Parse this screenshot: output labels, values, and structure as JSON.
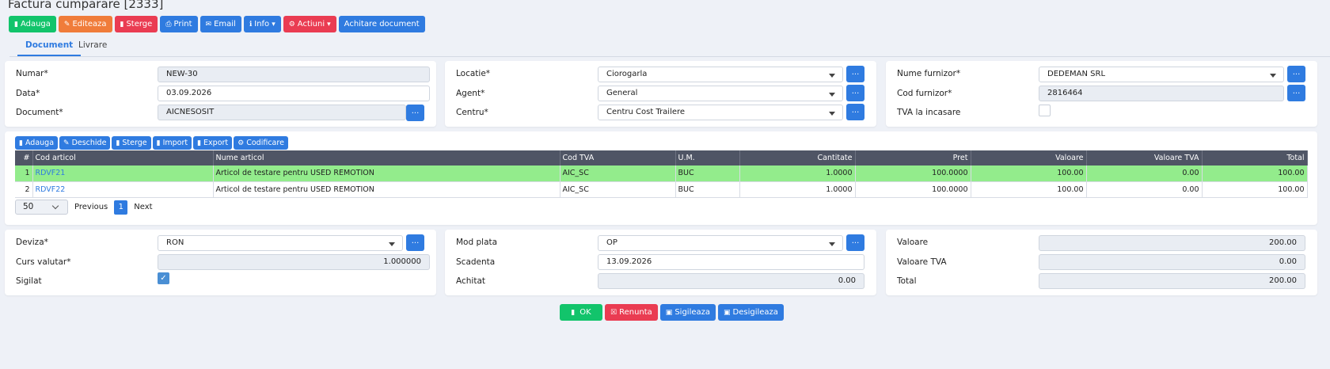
{
  "title": "Factura cumparare [2333]",
  "toolbar": {
    "add": "Adauga",
    "edit": "Editeaza",
    "delete": "Sterge",
    "print": "Print",
    "email": "Email",
    "info": "Info",
    "actions": "Actiuni",
    "pay": "Achitare document"
  },
  "tabs": {
    "document": "Document",
    "delivery": "Livrare"
  },
  "header": {
    "numar": {
      "label": "Numar*",
      "value": "NEW-30"
    },
    "data": {
      "label": "Data*",
      "value": "03.09.2026"
    },
    "document": {
      "label": "Document*",
      "value": "AICNESOSIT"
    },
    "locatie": {
      "label": "Locatie*",
      "value": "Ciorogarla"
    },
    "agent": {
      "label": "Agent*",
      "value": "General"
    },
    "centru": {
      "label": "Centru*",
      "value": "Centru Cost Trailere"
    },
    "furnizor": {
      "label": "Nume furnizor*",
      "value": "DEDEMAN SRL"
    },
    "cod_furnizor": {
      "label": "Cod furnizor*",
      "value": "2816464"
    },
    "tva_incasare": {
      "label": "TVA la incasare",
      "checked": false
    },
    "dots": "..."
  },
  "items_toolbar": {
    "add": "Adauga",
    "open": "Deschide",
    "delete": "Sterge",
    "import": "Import",
    "export": "Export",
    "coding": "Codificare"
  },
  "table": {
    "columns": [
      "#",
      "Cod articol",
      "Nume articol",
      "Cod TVA",
      "U.M.",
      "Cantitate",
      "Pret",
      "Valoare",
      "Valoare TVA",
      "Total"
    ],
    "rows": [
      [
        "1",
        "RDVF21",
        "Articol de testare pentru USED REMOTION",
        "AIC_SC",
        "BUC",
        "1.0000",
        "100.0000",
        "100.00",
        "0.00",
        "100.00"
      ],
      [
        "2",
        "RDVF22",
        "Articol de testare pentru USED REMOTION",
        "AIC_SC",
        "BUC",
        "1.0000",
        "100.0000",
        "100.00",
        "0.00",
        "100.00"
      ]
    ]
  },
  "pager": {
    "page_size": "50",
    "previous": "Previous",
    "page": "1",
    "next": "Next"
  },
  "footer": {
    "deviza": {
      "label": "Deviza*",
      "value": "RON"
    },
    "curs": {
      "label": "Curs valutar*",
      "value": "1.000000"
    },
    "sigilat": {
      "label": "Sigilat",
      "checked": true
    },
    "mod_plata": {
      "label": "Mod plata",
      "value": "OP"
    },
    "scadenta": {
      "label": "Scadenta",
      "value": "13.09.2026"
    },
    "achitat": {
      "label": "Achitat",
      "value": "0.00"
    },
    "valoare": {
      "label": "Valoare",
      "value": "200.00"
    },
    "valoare_tva": {
      "label": "Valoare TVA",
      "value": "0.00"
    },
    "total": {
      "label": "Total",
      "value": "200.00"
    }
  },
  "actions": {
    "ok": "OK",
    "cancel": "Renunta",
    "seal": "Sigileaza",
    "unseal": "Desigileaza"
  },
  "colors": {
    "primary": "#2f7be0",
    "success": "#12c46b",
    "danger": "#ea3c52",
    "warning": "#f07c3a",
    "selected_row": "#93ec8c",
    "table_header": "#4f5565"
  }
}
